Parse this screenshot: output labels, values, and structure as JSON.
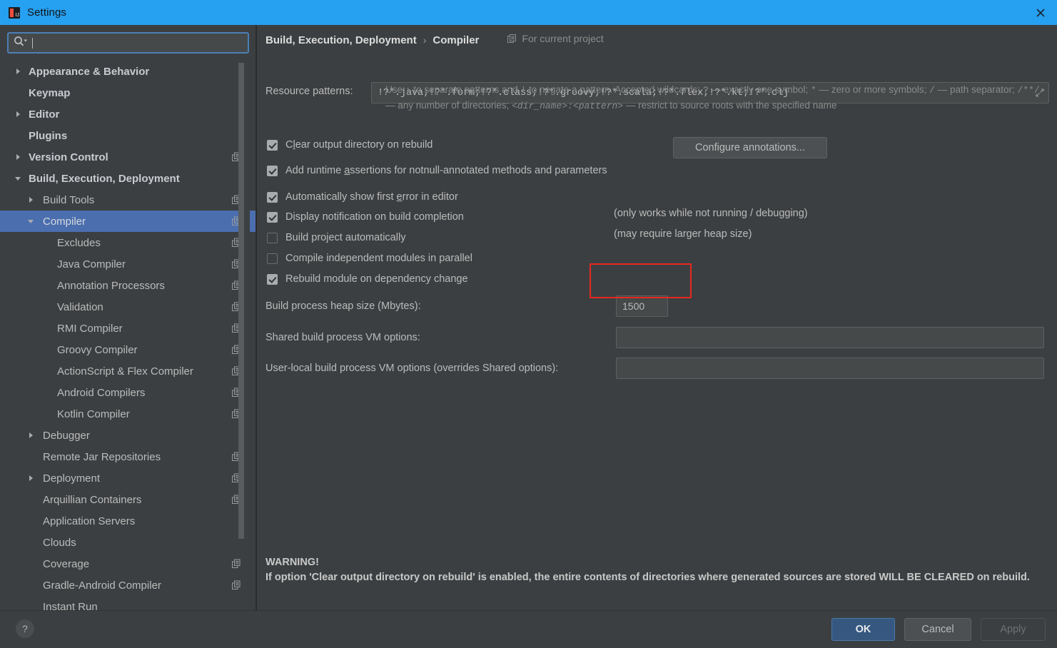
{
  "window": {
    "title": "Settings",
    "logo_icon": "intellij-idea-logo",
    "close_icon": "close-icon"
  },
  "search": {
    "icon": "search-icon",
    "dropdown_icon": "chevron-down-icon",
    "value": "",
    "placeholder": ""
  },
  "sidebar": {
    "items": [
      {
        "label": "Appearance & Behavior",
        "level": 0,
        "arrow": "collapsed",
        "cfg": false,
        "selected": false
      },
      {
        "label": "Keymap",
        "level": 0,
        "arrow": "none",
        "cfg": false,
        "selected": false
      },
      {
        "label": "Editor",
        "level": 0,
        "arrow": "collapsed",
        "cfg": false,
        "selected": false
      },
      {
        "label": "Plugins",
        "level": 0,
        "arrow": "none",
        "cfg": false,
        "selected": false
      },
      {
        "label": "Version Control",
        "level": 0,
        "arrow": "collapsed",
        "cfg": true,
        "selected": false
      },
      {
        "label": "Build, Execution, Deployment",
        "level": 0,
        "arrow": "expanded",
        "cfg": false,
        "selected": false
      },
      {
        "label": "Build Tools",
        "level": 1,
        "arrow": "collapsed",
        "cfg": true,
        "selected": false
      },
      {
        "label": "Compiler",
        "level": 1,
        "arrow": "expanded",
        "cfg": true,
        "selected": true
      },
      {
        "label": "Excludes",
        "level": 2,
        "arrow": "none",
        "cfg": true,
        "selected": false
      },
      {
        "label": "Java Compiler",
        "level": 2,
        "arrow": "none",
        "cfg": true,
        "selected": false
      },
      {
        "label": "Annotation Processors",
        "level": 2,
        "arrow": "none",
        "cfg": true,
        "selected": false
      },
      {
        "label": "Validation",
        "level": 2,
        "arrow": "none",
        "cfg": true,
        "selected": false
      },
      {
        "label": "RMI Compiler",
        "level": 2,
        "arrow": "none",
        "cfg": true,
        "selected": false
      },
      {
        "label": "Groovy Compiler",
        "level": 2,
        "arrow": "none",
        "cfg": true,
        "selected": false
      },
      {
        "label": "ActionScript & Flex Compiler",
        "level": 2,
        "arrow": "none",
        "cfg": true,
        "selected": false
      },
      {
        "label": "Android Compilers",
        "level": 2,
        "arrow": "none",
        "cfg": true,
        "selected": false
      },
      {
        "label": "Kotlin Compiler",
        "level": 2,
        "arrow": "none",
        "cfg": true,
        "selected": false
      },
      {
        "label": "Debugger",
        "level": 1,
        "arrow": "collapsed",
        "cfg": false,
        "selected": false
      },
      {
        "label": "Remote Jar Repositories",
        "level": 1,
        "arrow": "none",
        "cfg": true,
        "selected": false
      },
      {
        "label": "Deployment",
        "level": 1,
        "arrow": "collapsed",
        "cfg": true,
        "selected": false
      },
      {
        "label": "Arquillian Containers",
        "level": 1,
        "arrow": "none",
        "cfg": true,
        "selected": false
      },
      {
        "label": "Application Servers",
        "level": 1,
        "arrow": "none",
        "cfg": false,
        "selected": false
      },
      {
        "label": "Clouds",
        "level": 1,
        "arrow": "none",
        "cfg": false,
        "selected": false
      },
      {
        "label": "Coverage",
        "level": 1,
        "arrow": "none",
        "cfg": true,
        "selected": false
      },
      {
        "label": "Gradle-Android Compiler",
        "level": 1,
        "arrow": "none",
        "cfg": true,
        "selected": false
      },
      {
        "label": "Instant Run",
        "level": 1,
        "arrow": "none",
        "cfg": false,
        "selected": false
      }
    ]
  },
  "main": {
    "breadcrumb": {
      "root": "Build, Execution, Deployment",
      "separator": "›",
      "leaf": "Compiler",
      "scope_icon": "project-scope-icon",
      "scope_label": "For current project"
    },
    "resource_patterns": {
      "label": "Resource patterns:",
      "value": "!?*.java;!?*.form;!?*.class;!?*.groovy;!?*.scala;!?*.flex;!?*.kt;!?*.clj",
      "expand_icon": "expand-icon"
    },
    "hint_line1_a": "Use ",
    "hint_semicolon": ";",
    "hint_line1_b": " to separate patterns and ",
    "hint_bang": "!",
    "hint_line1_c": " to negate a pattern. Accepted wildcards: ",
    "hint_question": "?",
    "hint_line1_d": " — exactly one symbol; ",
    "hint_star": "*",
    "hint_line1_e": " — zero or more symbols; ",
    "hint_slash": "/",
    "hint_line2_a": " — path separator; ",
    "hint_globstar": "/**/",
    "hint_line2_b": " — any number of directories; ",
    "hint_dirname": "<dir_name>:<pattern>",
    "hint_line2_c": " — restrict to source roots with the specified name",
    "checkboxes": [
      {
        "label_pre": "C",
        "mnemonic": "l",
        "label_post": "ear output directory on rebuild",
        "checked": true
      },
      {
        "label_pre": "Add runtime ",
        "mnemonic": "a",
        "label_post": "ssertions for notnull-annotated methods and parameters",
        "checked": true
      },
      {
        "label_pre": "Automatically show first ",
        "mnemonic": "e",
        "label_post": "rror in editor",
        "checked": true
      },
      {
        "label_pre": "Display notification on build completion",
        "mnemonic": "",
        "label_post": "",
        "checked": true
      },
      {
        "label_pre": "Build project automatically",
        "mnemonic": "",
        "label_post": "",
        "checked": false
      },
      {
        "label_pre": "Compile independent modules in parallel",
        "mnemonic": "",
        "label_post": "",
        "checked": false
      },
      {
        "label_pre": "Rebuild module on dependency change",
        "mnemonic": "",
        "label_post": "",
        "checked": true
      }
    ],
    "configure_annotations_button": "Configure annotations...",
    "note_build_automatically": "(only works while not running / debugging)",
    "note_parallel": "(may require larger heap size)",
    "heap_size": {
      "label": "Build process heap size (Mbytes):",
      "value": "1500",
      "annotation_color": "#e8281e"
    },
    "shared_vm": {
      "label": "Shared build process VM options:",
      "value": ""
    },
    "user_local_vm": {
      "label": "User-local build process VM options (overrides Shared options):",
      "value": ""
    },
    "warning_title": "WARNING!",
    "warning_body": "If option 'Clear output directory on rebuild' is enabled, the entire contents of directories where generated sources are stored WILL BE CLEARED on rebuild."
  },
  "footer": {
    "help_icon": "?",
    "ok": "OK",
    "cancel": "Cancel",
    "apply": "Apply"
  },
  "colors": {
    "titlebar": "#26a0f0",
    "background": "#3c3f41",
    "selection": "#4b6eaf",
    "field": "#45494a",
    "primary_button": "#365880",
    "annotation": "#e8281e"
  }
}
